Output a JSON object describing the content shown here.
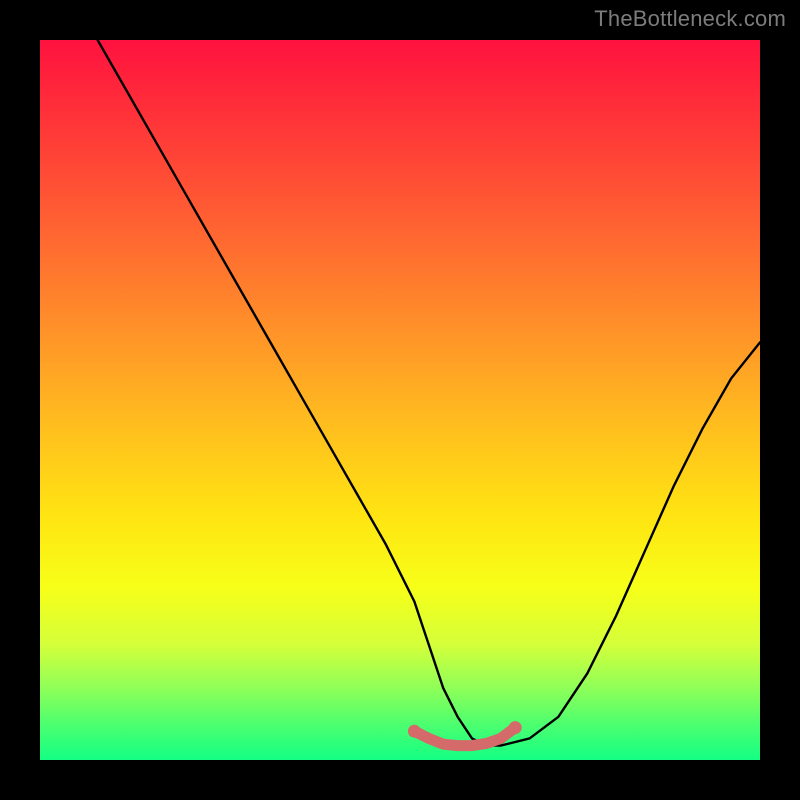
{
  "watermark": "TheBottleneck.com",
  "chart_data": {
    "type": "line",
    "title": "",
    "xlabel": "",
    "ylabel": "",
    "xlim": [
      0,
      100
    ],
    "ylim": [
      0,
      100
    ],
    "series": [
      {
        "name": "bottleneck-curve",
        "x": [
          8,
          12,
          16,
          20,
          24,
          28,
          32,
          36,
          40,
          44,
          48,
          52,
          54,
          56,
          58,
          60,
          62,
          64,
          68,
          72,
          76,
          80,
          84,
          88,
          92,
          96,
          100
        ],
        "y": [
          100,
          93,
          86,
          79,
          72,
          65,
          58,
          51,
          44,
          37,
          30,
          22,
          16,
          10,
          6,
          3,
          2,
          2,
          3,
          6,
          12,
          20,
          29,
          38,
          46,
          53,
          58
        ]
      }
    ],
    "highlight": {
      "name": "optimal-zone",
      "x": [
        52,
        54,
        56,
        58,
        60,
        62,
        64,
        66
      ],
      "y": [
        4,
        3,
        2.2,
        2,
        2,
        2.3,
        3,
        4.5
      ]
    },
    "gradient_stops": [
      {
        "pos": 0,
        "color": "#ff123f"
      },
      {
        "pos": 8,
        "color": "#ff2a3a"
      },
      {
        "pos": 22,
        "color": "#ff5634"
      },
      {
        "pos": 38,
        "color": "#ff8a2a"
      },
      {
        "pos": 52,
        "color": "#ffb920"
      },
      {
        "pos": 66,
        "color": "#ffe412"
      },
      {
        "pos": 76,
        "color": "#f7ff18"
      },
      {
        "pos": 84,
        "color": "#d4ff3a"
      },
      {
        "pos": 90,
        "color": "#8fff58"
      },
      {
        "pos": 95,
        "color": "#4dff6f"
      },
      {
        "pos": 100,
        "color": "#13ff84"
      }
    ]
  }
}
